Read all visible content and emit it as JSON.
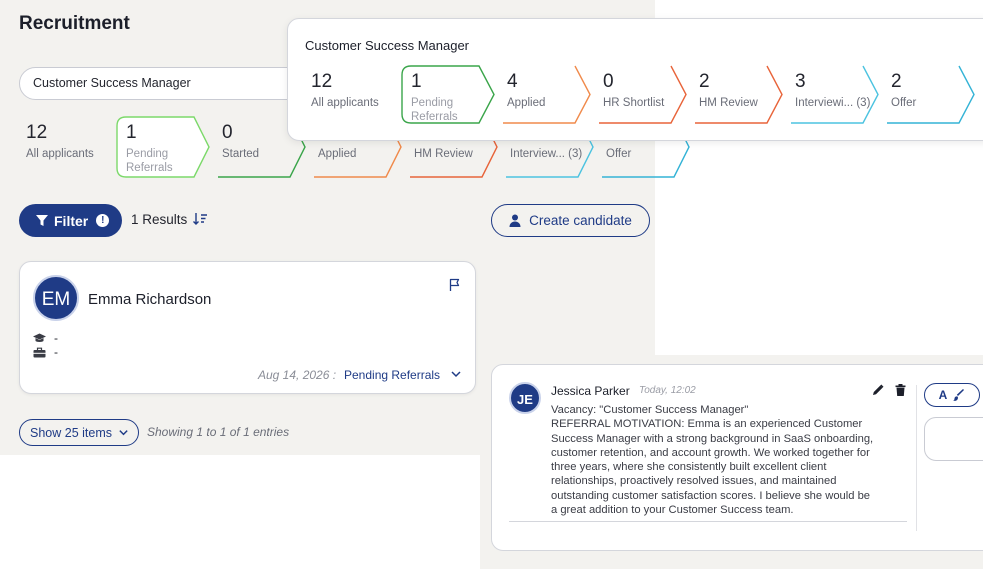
{
  "page": {
    "title": "Recruitment"
  },
  "vacancy": {
    "selected": "Customer Success Manager"
  },
  "pipeline": [
    {
      "count": "12",
      "label": "All applicants",
      "color": ""
    },
    {
      "count": "1",
      "label": "Pending Referrals",
      "color": "#7cd96a"
    },
    {
      "count": "0",
      "label": "Started",
      "color": "#3aa54a"
    },
    {
      "count": "",
      "label": "Applied",
      "color": "#f08a4b"
    },
    {
      "count": "",
      "label": "HM Review",
      "color": "#e8643a"
    },
    {
      "count": "",
      "label": "Interview... (3)",
      "color": "#4cc3e0"
    },
    {
      "count": "",
      "label": "Offer",
      "color": "#34b3d6"
    }
  ],
  "popup": {
    "title": "Customer Success Manager",
    "stages": [
      {
        "count": "12",
        "label": "All applicants",
        "color": ""
      },
      {
        "count": "1",
        "label": "Pending Referrals",
        "color": "#3aa54a"
      },
      {
        "count": "4",
        "label": "Applied",
        "color": "#f08a4b"
      },
      {
        "count": "0",
        "label": "HR Shortlist",
        "color": "#e8643a"
      },
      {
        "count": "2",
        "label": "HM Review",
        "color": "#e8643a"
      },
      {
        "count": "3",
        "label": "Interviewi... (3)",
        "color": "#4cc3e0"
      },
      {
        "count": "2",
        "label": "Offer",
        "color": "#34b3d6"
      }
    ]
  },
  "toolbar": {
    "filter_label": "Filter",
    "filter_badge": "!",
    "results": "1 Results",
    "create_label": "Create candidate"
  },
  "candidate": {
    "initials": "EM",
    "name": "Emma Richardson",
    "education": "-",
    "experience": "-",
    "date": "Aug 14, 2026 :",
    "status": "Pending Referrals"
  },
  "pagination": {
    "page_size_label": "Show 25 items",
    "showing": "Showing 1 to 1 of 1 entries"
  },
  "comment": {
    "initials": "JE",
    "author": "Jessica Parker",
    "time": "Today, 12:02",
    "lines": [
      "Vacancy: \"Customer Success Manager\"",
      "REFERRAL MOTIVATION: Emma is an experienced Customer",
      "Success Manager with a strong background in SaaS onboarding,",
      "customer retention, and account growth. We worked together for",
      "three years, where she consistently built excellent client",
      "relationships, proactively resolved issues, and maintained",
      "outstanding customer satisfaction scores. I believe she would be",
      "a great addition to your Customer Success team."
    ],
    "tools_label": "A"
  },
  "colors": {
    "primary": "#1f3b86",
    "background": "#f3f2ef"
  }
}
